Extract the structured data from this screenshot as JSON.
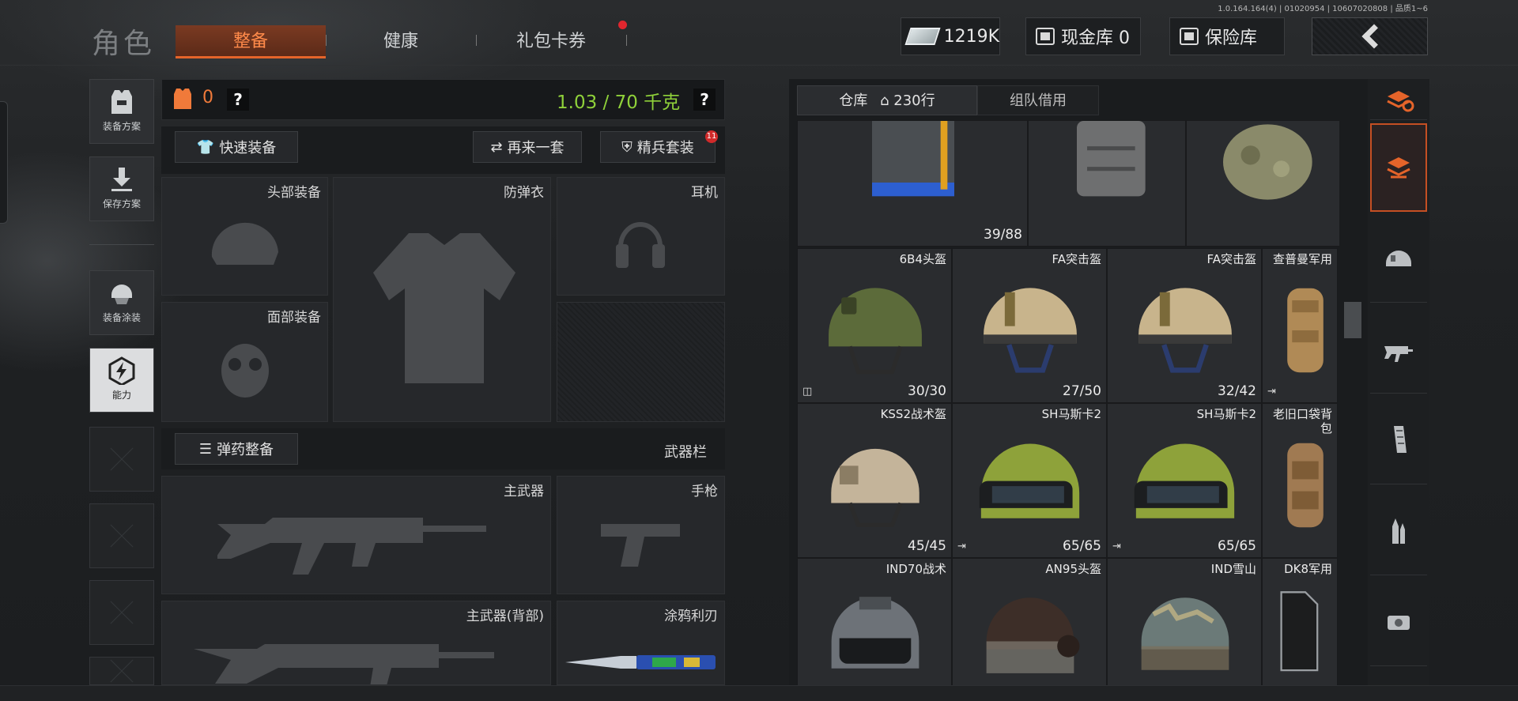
{
  "version": "1.0.164.164(4) | 01020954 | 10607020808 | 品质1~6",
  "header": {
    "title": "角色",
    "tabs": [
      {
        "label": "整备",
        "active": true
      },
      {
        "label": "健康",
        "active": false
      },
      {
        "label": "礼包卡券",
        "active": false,
        "notify": true
      }
    ],
    "money": "1219K",
    "cash_vault": "现金库 0",
    "safe_vault": "保险库",
    "back_icon": "back-arrow-icon"
  },
  "side_nav": [
    {
      "label": "装备方案",
      "icon": "vest-icon",
      "active": false
    },
    {
      "label": "保存方案",
      "icon": "download-icon",
      "active": false
    },
    {
      "label": "装备涂装",
      "icon": "helmet-skin-icon",
      "active": false
    },
    {
      "label": "能力",
      "icon": "lightning-hex-icon",
      "active": true
    }
  ],
  "equipment": {
    "armor_count": "0",
    "help": "?",
    "weight": "1.03 / 70 千克",
    "quick_equip": "快速装备",
    "reroll": "再来一套",
    "elite_set": "精兵套装",
    "elite_badge": "11",
    "slots": {
      "head": "头部装备",
      "armor": "防弹衣",
      "headset": "耳机",
      "face": "面部装备"
    },
    "ammo_button": "弹药整备",
    "weapon_bar": "武器栏",
    "weapon_slots": {
      "primary": "主武器",
      "pistol": "手枪",
      "primary_back": "主武器(背部)",
      "knife": "涂鸦利刃"
    }
  },
  "warehouse": {
    "tab_storage": "仓库",
    "tab_rows": "230行",
    "tab_team": "组队借用",
    "rows": [
      [
        {
          "name": "",
          "dur": "39/88",
          "kind": "vest-blue"
        },
        {
          "name": "",
          "dur": "",
          "kind": "vest-grey"
        },
        {
          "name": "",
          "dur": "",
          "kind": "pack-camo"
        }
      ],
      [
        {
          "name": "6B4头盔",
          "dur": "30/30",
          "kind": "helmet-green",
          "flag": "◫"
        },
        {
          "name": "FA突击盔",
          "dur": "27/50",
          "kind": "helmet-tan"
        },
        {
          "name": "FA突击盔",
          "dur": "32/42",
          "kind": "helmet-tan"
        },
        {
          "name": "查普曼军用",
          "dur": "",
          "kind": "bag-tan",
          "flag": "⇥"
        }
      ],
      [
        {
          "name": "KSS2战术盔",
          "dur": "45/45",
          "kind": "helmet-sand"
        },
        {
          "name": "SH马斯卡2",
          "dur": "65/65",
          "kind": "helmet-visor",
          "flag": "⇥"
        },
        {
          "name": "SH马斯卡2",
          "dur": "65/65",
          "kind": "helmet-visor",
          "flag": "⇥"
        },
        {
          "name": "老旧口袋背包",
          "dur": "",
          "kind": "bag-brown"
        }
      ],
      [
        {
          "name": "IND70战术",
          "dur": "",
          "kind": "helmet-grey"
        },
        {
          "name": "AN95头盔",
          "dur": "",
          "kind": "helmet-dark"
        },
        {
          "name": "IND雪山",
          "dur": "",
          "kind": "helmet-camo"
        },
        {
          "name": "DK8军用",
          "dur": "",
          "kind": "shield-visor"
        }
      ]
    ]
  },
  "rail": [
    {
      "icon": "stack-refresh-icon",
      "active": false
    },
    {
      "icon": "layers-sort-icon",
      "active": true
    },
    {
      "icon": "helmet-category-icon",
      "active": false
    },
    {
      "icon": "rifle-category-icon",
      "active": false
    },
    {
      "icon": "magazine-category-icon",
      "active": false
    },
    {
      "icon": "ammo-category-icon",
      "active": false
    },
    {
      "icon": "sight-category-icon",
      "active": false
    }
  ],
  "colors": {
    "accent": "#e5642a",
    "weight_green": "#8fd13a",
    "alert_red": "#d12a2a"
  }
}
